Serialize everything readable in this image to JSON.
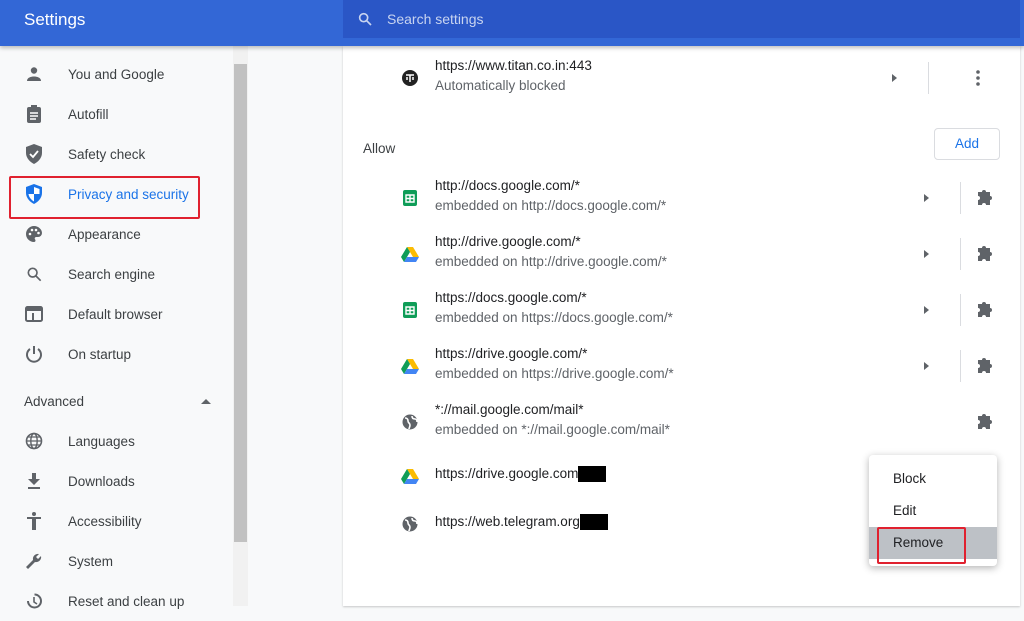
{
  "header": {
    "title": "Settings",
    "search_placeholder": "Search settings"
  },
  "sidebar": {
    "items": [
      {
        "label": "You and Google",
        "icon": "person-icon"
      },
      {
        "label": "Autofill",
        "icon": "clipboard-icon"
      },
      {
        "label": "Safety check",
        "icon": "shield-check-icon"
      },
      {
        "label": "Privacy and security",
        "icon": "shield-icon",
        "active": true
      },
      {
        "label": "Appearance",
        "icon": "palette-icon"
      },
      {
        "label": "Search engine",
        "icon": "search-icon"
      },
      {
        "label": "Default browser",
        "icon": "browser-icon"
      },
      {
        "label": "On startup",
        "icon": "power-icon"
      }
    ],
    "advanced_label": "Advanced",
    "advanced_items": [
      {
        "label": "Languages",
        "icon": "globe-icon"
      },
      {
        "label": "Downloads",
        "icon": "download-icon"
      },
      {
        "label": "Accessibility",
        "icon": "accessibility-icon"
      },
      {
        "label": "System",
        "icon": "wrench-icon"
      },
      {
        "label": "Reset and clean up",
        "icon": "history-icon"
      }
    ]
  },
  "main": {
    "blocked_site": {
      "url": "https://www.titan.co.in:443",
      "sub": "Automatically blocked"
    },
    "allow_label": "Allow",
    "add_label": "Add",
    "allow_sites": [
      {
        "url": "http://docs.google.com/*",
        "sub": "embedded on http://docs.google.com/*",
        "icon": "sheets-icon"
      },
      {
        "url": "http://drive.google.com/*",
        "sub": "embedded on http://drive.google.com/*",
        "icon": "drive-icon"
      },
      {
        "url": "https://docs.google.com/*",
        "sub": "embedded on https://docs.google.com/*",
        "icon": "sheets-icon"
      },
      {
        "url": "https://drive.google.com/*",
        "sub": "embedded on https://drive.google.com/*",
        "icon": "drive-icon"
      },
      {
        "url": "*://mail.google.com/mail*",
        "sub": "embedded on *://mail.google.com/mail*",
        "icon": "globe-icon"
      },
      {
        "url": "https://drive.google.com",
        "icon": "drive-icon"
      },
      {
        "url": "https://web.telegram.org",
        "icon": "globe-icon"
      }
    ]
  },
  "context_menu": {
    "items": [
      "Block",
      "Edit",
      "Remove"
    ],
    "highlighted": "Remove"
  },
  "colors": {
    "header": "#3367d6",
    "search": "#2a56c6",
    "accent": "#1a73e8",
    "highlight_box": "#e0212f"
  }
}
